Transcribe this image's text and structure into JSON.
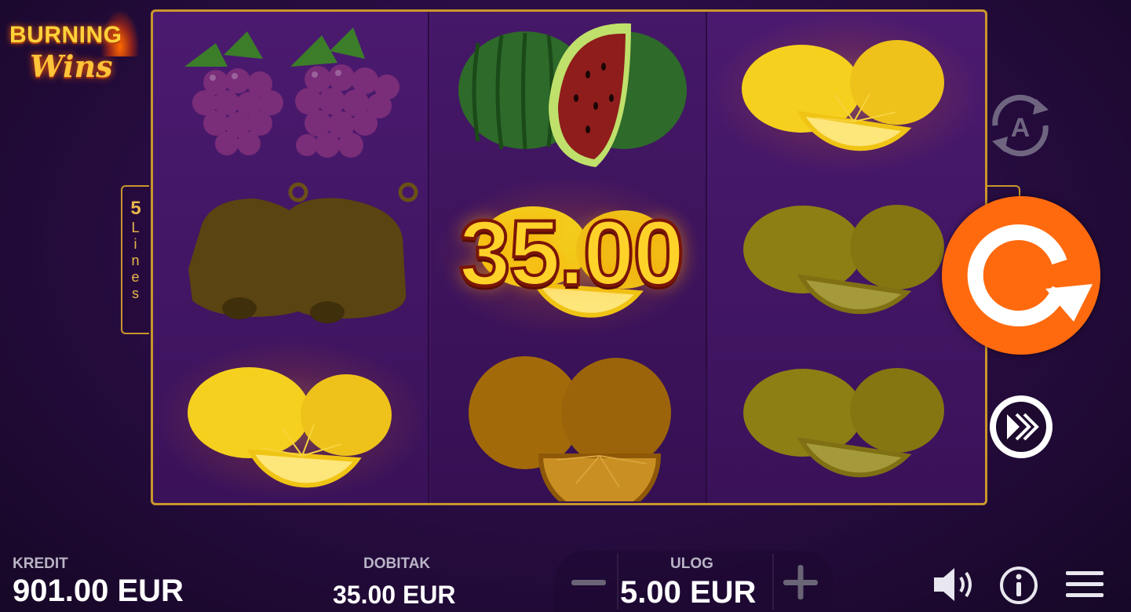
{
  "game": {
    "logo_line1": "BURNING",
    "logo_line2": "Wins",
    "lines_count": "5",
    "lines_word": [
      "L",
      "i",
      "n",
      "e",
      "s"
    ],
    "win_overlay": "35.00"
  },
  "reels": [
    [
      "grapes",
      "bell",
      "lemon"
    ],
    [
      "watermelon",
      "lemon",
      "orange"
    ],
    [
      "lemon",
      "lemon",
      "lemon"
    ]
  ],
  "bottom_bar": {
    "credit_label": "KREDIT",
    "credit_value": "901.00 EUR",
    "win_label": "DOBITAK",
    "win_value": "35.00 EUR",
    "bet_label": "ULOG",
    "bet_value": "5.00 EUR"
  },
  "controls": {
    "autoplay_icon": "autoplay-icon",
    "spin_icon": "spin-icon",
    "turbo_icon": "turbo-icon",
    "sound_icon": "sound-icon",
    "info_icon": "info-icon",
    "menu_icon": "menu-icon",
    "minus_icon": "minus-icon",
    "plus_icon": "plus-icon"
  },
  "colors": {
    "spin_button": "#ff6a0e",
    "reel_frame": "#c9962b",
    "win_text": "#ffd22a"
  }
}
